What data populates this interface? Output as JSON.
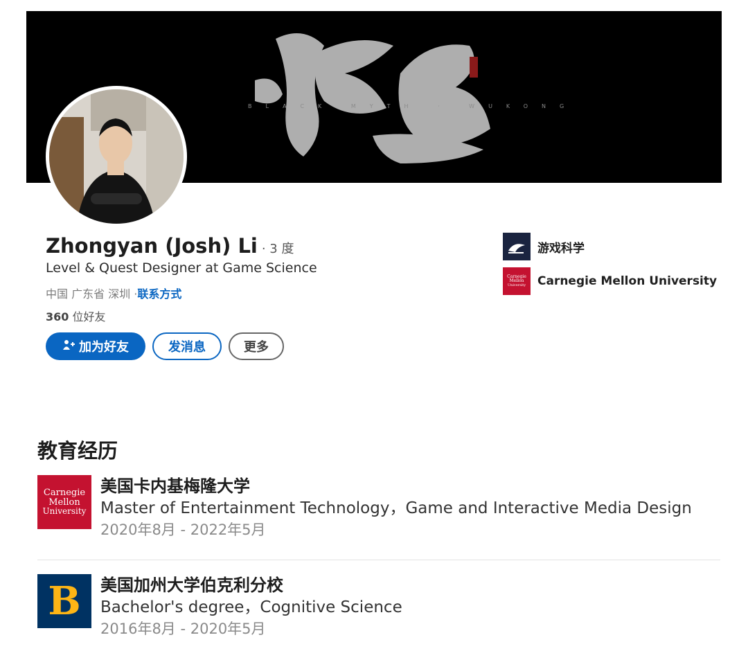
{
  "banner": {
    "art_title": "悟空",
    "subtitle_caps": "BLACK MYTH · WUKONG"
  },
  "profile": {
    "name": "Zhongyan (Josh) Li",
    "connection_degree": "· 3 度",
    "headline": "Level & Quest Designer at Game Science",
    "location": "中国 广东省 深圳 · ",
    "contact_link": "联系方式",
    "friends_count": "360",
    "friends_suffix": " 位好友"
  },
  "actions": {
    "add_friend": "加为好友",
    "message": "发消息",
    "more": "更多"
  },
  "orgs": [
    {
      "name": "游戏科学",
      "icon": "game-science-logo"
    },
    {
      "name": "Carnegie Mellon University",
      "icon": "cmu-logo"
    }
  ],
  "education": {
    "title": "教育经历",
    "items": [
      {
        "school": "美国卡内基梅隆大学",
        "degree": "Master of Entertainment Technology，Game and Interactive Media Design",
        "dates": "2020年8月 - 2022年5月",
        "logo_lines": [
          "Carnegie",
          "Mellon",
          "University"
        ]
      },
      {
        "school": "美国加州大学伯克利分校",
        "degree": "Bachelor's degree，Cognitive Science",
        "dates": "2016年8月 - 2020年5月",
        "logo_letter": "B"
      }
    ]
  },
  "colors": {
    "accent": "#0a66c2",
    "cmu_red": "#c41230",
    "berkeley_blue": "#003262",
    "berkeley_gold": "#fdb515"
  }
}
